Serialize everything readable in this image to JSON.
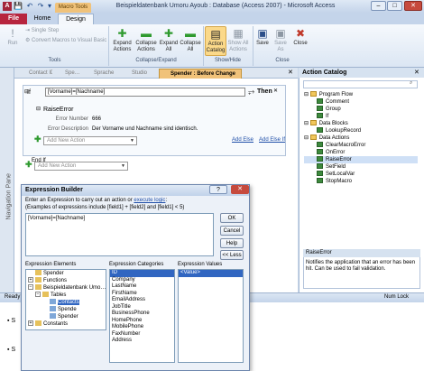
{
  "window": {
    "title": "Beispieldatenbank Umoru Ayoub : Database (Access 2007) - Microsoft Access",
    "app_icon": "A",
    "contextual_tab": "Macro Tools",
    "controls": {
      "minimize": "–",
      "maximize": "□",
      "close": "✕"
    }
  },
  "qat": {
    "save": "💾",
    "undo": "↶",
    "redo": "↷",
    "dropdown": "▾"
  },
  "tabs": {
    "file": "File",
    "home": "Home",
    "design": "Design"
  },
  "ribbon": {
    "run": "Run",
    "single_step": "Single Step",
    "convert_macros": "Convert Macros to Visual Basic",
    "tools_group": "Tools",
    "expand_actions": "Expand Actions",
    "collapse_actions": "Collapse Actions",
    "expand_all": "Expand All",
    "collapse_all": "Collapse All",
    "collapse_group": "Collapse/Expand",
    "action_catalog": "Action Catalog",
    "show_all_actions": "Show All Actions",
    "show_hide_group": "Show/Hide",
    "save": "Save",
    "save_as": "Save As",
    "close": "Close",
    "close_group": "Close"
  },
  "object_tabs": [
    "Contact ID",
    "Spe…",
    "Sprache",
    "Studio",
    "Spender : Before Change"
  ],
  "nav_pane": "Navigation Pane",
  "macro": {
    "if_label": "If",
    "condition": "[Vorname]=[Nachname]",
    "then_label": "Then",
    "action": "RaiseError",
    "error_number_label": "Error Number",
    "error_number": "666",
    "error_desc_label": "Error Description",
    "error_desc": "Der Vorname und Nachname sind identisch.",
    "add_action_placeholder": "Add New Action",
    "add_else": "Add Else",
    "add_else_if": "Add Else If",
    "end_if": "End If",
    "add_action_placeholder_2": "Add New Action"
  },
  "catalog": {
    "title": "Action Catalog",
    "items": [
      {
        "label": "Program Flow",
        "kind": "folder"
      },
      {
        "label": "Comment",
        "kind": "action"
      },
      {
        "label": "Group",
        "kind": "action"
      },
      {
        "label": "If",
        "kind": "action"
      },
      {
        "label": "Data Blocks",
        "kind": "folder"
      },
      {
        "label": "LookupRecord",
        "kind": "action"
      },
      {
        "label": "Data Actions",
        "kind": "folder"
      },
      {
        "label": "ClearMacroError",
        "kind": "action"
      },
      {
        "label": "OnError",
        "kind": "action"
      },
      {
        "label": "RaiseError",
        "kind": "action",
        "selected": true
      },
      {
        "label": "SetField",
        "kind": "action"
      },
      {
        "label": "SetLocalVar",
        "kind": "action"
      },
      {
        "label": "StopMacro",
        "kind": "action"
      }
    ],
    "info_title": "RaiseError",
    "info_desc": "Notifies the application that an error has been hit. Can be used to fail validation."
  },
  "status": {
    "left": "Ready",
    "right": "Num Lock"
  },
  "bottom_bullets": [
    "S",
    "S"
  ],
  "dialog": {
    "title": "Expression Builder",
    "prompt_prefix": "Enter an Expression to carry out an action or",
    "prompt_link": "execute logic",
    "prompt_suffix": ":",
    "example": "(Examples of expressions include [field1] + [field2] and [field1] < 5)",
    "expression": "[Vorname]=[Nachname]",
    "buttons": {
      "ok": "OK",
      "cancel": "Cancel",
      "help": "Help",
      "less": "<< Less"
    },
    "elements_header": "Expression Elements",
    "categories_header": "Expression Categories",
    "values_header": "Expression Values",
    "elements": [
      {
        "label": "Spender",
        "indent": 0,
        "box": ""
      },
      {
        "label": "Functions",
        "indent": 0,
        "box": "+"
      },
      {
        "label": "Beispieldatenbank Umo…",
        "indent": 0,
        "box": "−"
      },
      {
        "label": "Tables",
        "indent": 1,
        "box": "−"
      },
      {
        "label": "Contacts",
        "indent": 2,
        "box": "",
        "selected": true
      },
      {
        "label": "Spende",
        "indent": 2,
        "box": ""
      },
      {
        "label": "Spender",
        "indent": 2,
        "box": ""
      },
      {
        "label": "Constants",
        "indent": 0,
        "box": "+"
      }
    ],
    "categories": [
      "ID",
      "Company",
      "LastName",
      "FirstName",
      "EmailAddress",
      "JobTitle",
      "BusinessPhone",
      "HomePhone",
      "MobilePhone",
      "FaxNumber",
      "Address"
    ],
    "values": [
      "<Value>"
    ]
  },
  "colors": {
    "file_tab": "#b7253e",
    "contextual": "#f0c27a",
    "selection": "#3166c1",
    "link": "#1f4ea8"
  }
}
